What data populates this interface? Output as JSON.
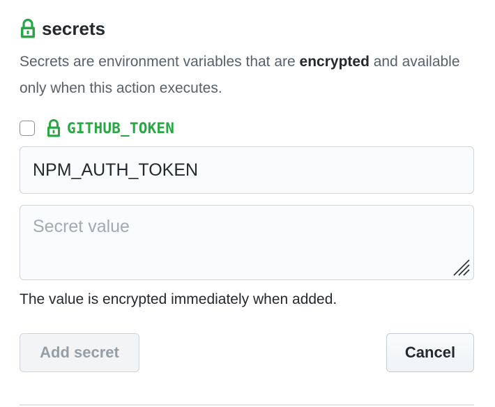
{
  "secrets_panel": {
    "heading": "secrets",
    "lock_icon": "lock-icon",
    "accent_color": "#28a745",
    "description_part1": "Secrets are environment variables that are ",
    "description_bold": "encrypted",
    "description_part2": " and available only when this action executes.",
    "github_token": {
      "label": "GITHUB_TOKEN",
      "checked": false,
      "icon": "lock-icon"
    },
    "name_input": {
      "value": "NPM_AUTH_TOKEN"
    },
    "value_input": {
      "value": "",
      "placeholder": "Secret value"
    },
    "help_text": "The value is encrypted immediately when added.",
    "add_button_label": "Add secret",
    "cancel_button_label": "Cancel"
  }
}
